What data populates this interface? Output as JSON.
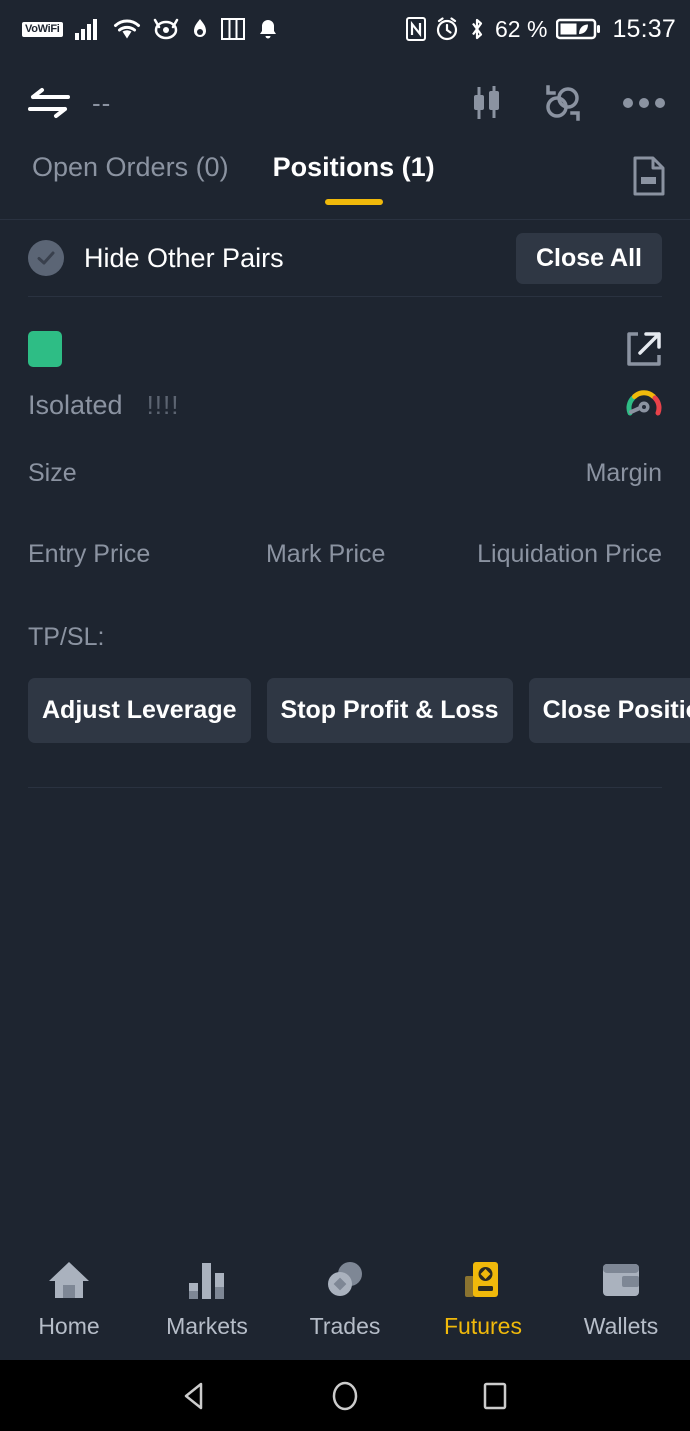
{
  "statusbar": {
    "vowifi": "VoWiFi",
    "icons_left": [
      "signal-icon",
      "wifi-icon",
      "eye-icon",
      "hotspot-icon",
      "columns-icon",
      "bell-icon"
    ],
    "icons_right": [
      "nfc-icon",
      "alarm-icon",
      "bluetooth-icon"
    ],
    "battery_percent": "62 %",
    "time": "15:37"
  },
  "appbar": {
    "swap_icon": "transfer-arrows-icon",
    "pair": "--",
    "chart_icon": "candlestick-icon",
    "tools_icon": "calculator-icon",
    "more_icon": "more-horizontal-icon"
  },
  "tabs": {
    "items": [
      {
        "label": "Open Orders (0)",
        "active": false
      },
      {
        "label": "Positions (1)",
        "active": true
      }
    ],
    "history_icon": "order-history-icon",
    "accent": "#f0b90b"
  },
  "filter": {
    "hide_other_pairs": "Hide Other Pairs",
    "checked": true,
    "close_all": "Close All"
  },
  "position": {
    "side_color": "#2ebd85",
    "share_icon": "share-external-icon",
    "margin_mode": "Isolated",
    "leverage": "!!!!",
    "risk_gauge_icon": "risk-gauge-icon",
    "labels": {
      "size": "Size",
      "margin": "Margin",
      "entry_price": "Entry Price",
      "mark_price": "Mark Price",
      "liquidation_price": "Liquidation Price",
      "tpsl": "TP/SL:"
    },
    "actions": [
      "Adjust Leverage",
      "Stop Profit & Loss",
      "Close Position"
    ]
  },
  "bottomnav": {
    "items": [
      {
        "label": "Home",
        "icon": "home-icon",
        "active": false
      },
      {
        "label": "Markets",
        "icon": "bar-chart-icon",
        "active": false
      },
      {
        "label": "Trades",
        "icon": "coins-icon",
        "active": false
      },
      {
        "label": "Futures",
        "icon": "futures-card-icon",
        "active": true
      },
      {
        "label": "Wallets",
        "icon": "wallet-icon",
        "active": false
      }
    ],
    "active_color": "#f0b90b"
  },
  "androidnav": {
    "back": "back-triangle-icon",
    "home": "home-circle-icon",
    "recents": "recents-square-icon"
  }
}
